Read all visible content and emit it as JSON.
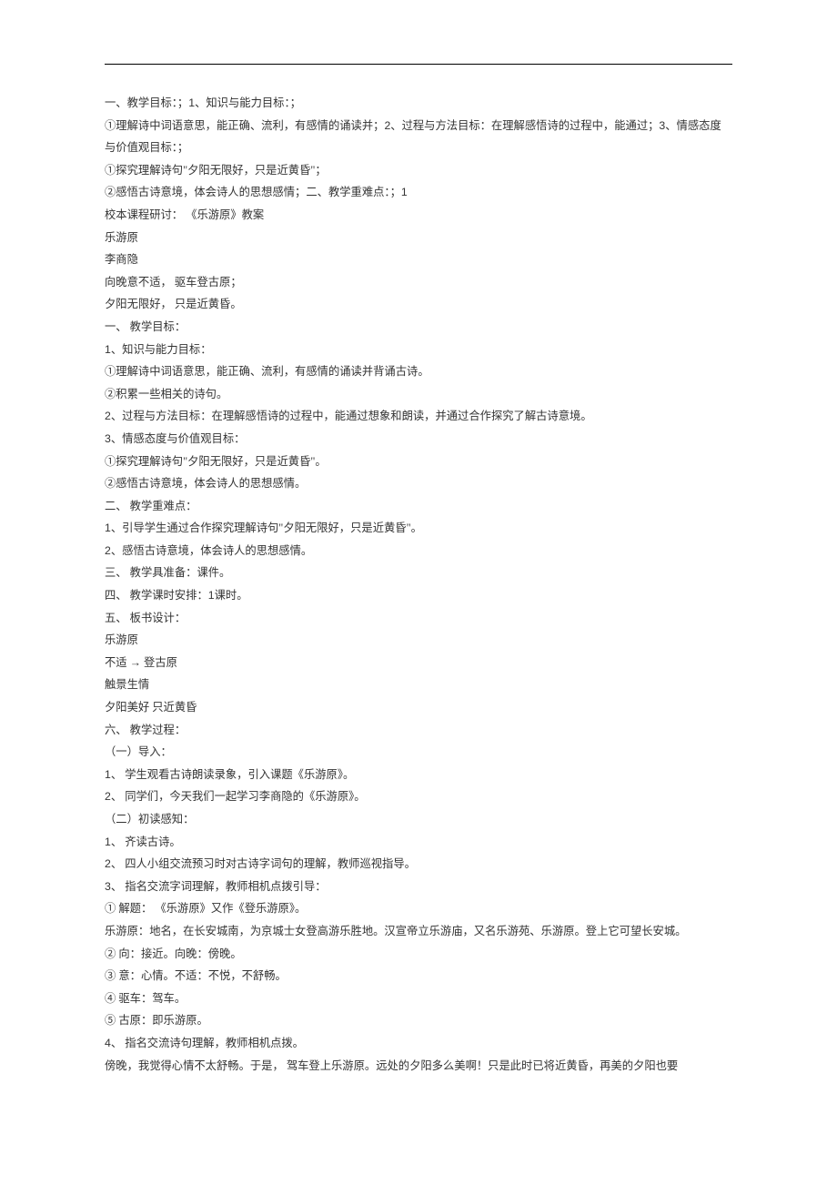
{
  "lines": [
    "一、教学目标：；1、知识与能力目标：；",
    "①理解诗中词语意思，能正确、流利，有感情的诵读并；2、过程与方法目标：在理解感悟诗的过程中，能通过；3、情感态度与价值观目标：；",
    "①探究理解诗句\"夕阳无限好，只是近黄昏\"；",
    "②感悟古诗意境，体会诗人的思想感情；二、教学重难点：；1",
    "校本课程研讨： 《乐游原》教案",
    "乐游原",
    "李商隐",
    "向晚意不适， 驱车登古原；",
    "夕阳无限好， 只是近黄昏。",
    "一、 教学目标：",
    "1、知识与能力目标：",
    "①理解诗中词语意思，能正确、流利，有感情的诵读并背诵古诗。",
    "②积累一些相关的诗句。",
    "2、过程与方法目标：在理解感悟诗的过程中，能通过想象和朗读，并通过合作探究了解古诗意境。",
    "3、情感态度与价值观目标：",
    "①探究理解诗句\"夕阳无限好，只是近黄昏\"。",
    "②感悟古诗意境，体会诗人的思想感情。",
    "二、 教学重难点：",
    "1、引导学生通过合作探究理解诗句\"夕阳无限好，只是近黄昏\"。",
    "2、感悟古诗意境，体会诗人的思想感情。",
    "三、 教学具准备：课件。",
    "四、 教学课时安排：1课时。",
    "五、 板书设计：",
    "乐游原",
    "不适 → 登古原",
    "触景生情",
    "夕阳美好 只近黄昏",
    "六、 教学过程：",
    "（一）导入：",
    "1、 学生观看古诗朗读录象，引入课题《乐游原》。",
    "2、 同学们，今天我们一起学习李商隐的《乐游原》。",
    "（二）初读感知：",
    "1、 齐读古诗。",
    "2、 四人小组交流预习时对古诗字词句的理解，教师巡视指导。",
    "3、 指名交流字词理解，教师相机点拨引导：",
    "① 解题： 《乐游原》又作《登乐游原》。",
    "乐游原：地名，在长安城南，为京城士女登高游乐胜地。汉宣帝立乐游庙，又名乐游苑、乐游原。登上它可望长安城。",
    "② 向：接近。向晚：傍晚。",
    "③ 意：心情。不适：不悦，不舒畅。",
    "④ 驱车：驾车。",
    "⑤ 古原：即乐游原。",
    "4、 指名交流诗句理解，教师相机点拨。",
    "傍晚，我觉得心情不太舒畅。于是， 驾车登上乐游原。远处的夕阳多么美啊！只是此时已将近黄昏，再美的夕阳也要"
  ]
}
